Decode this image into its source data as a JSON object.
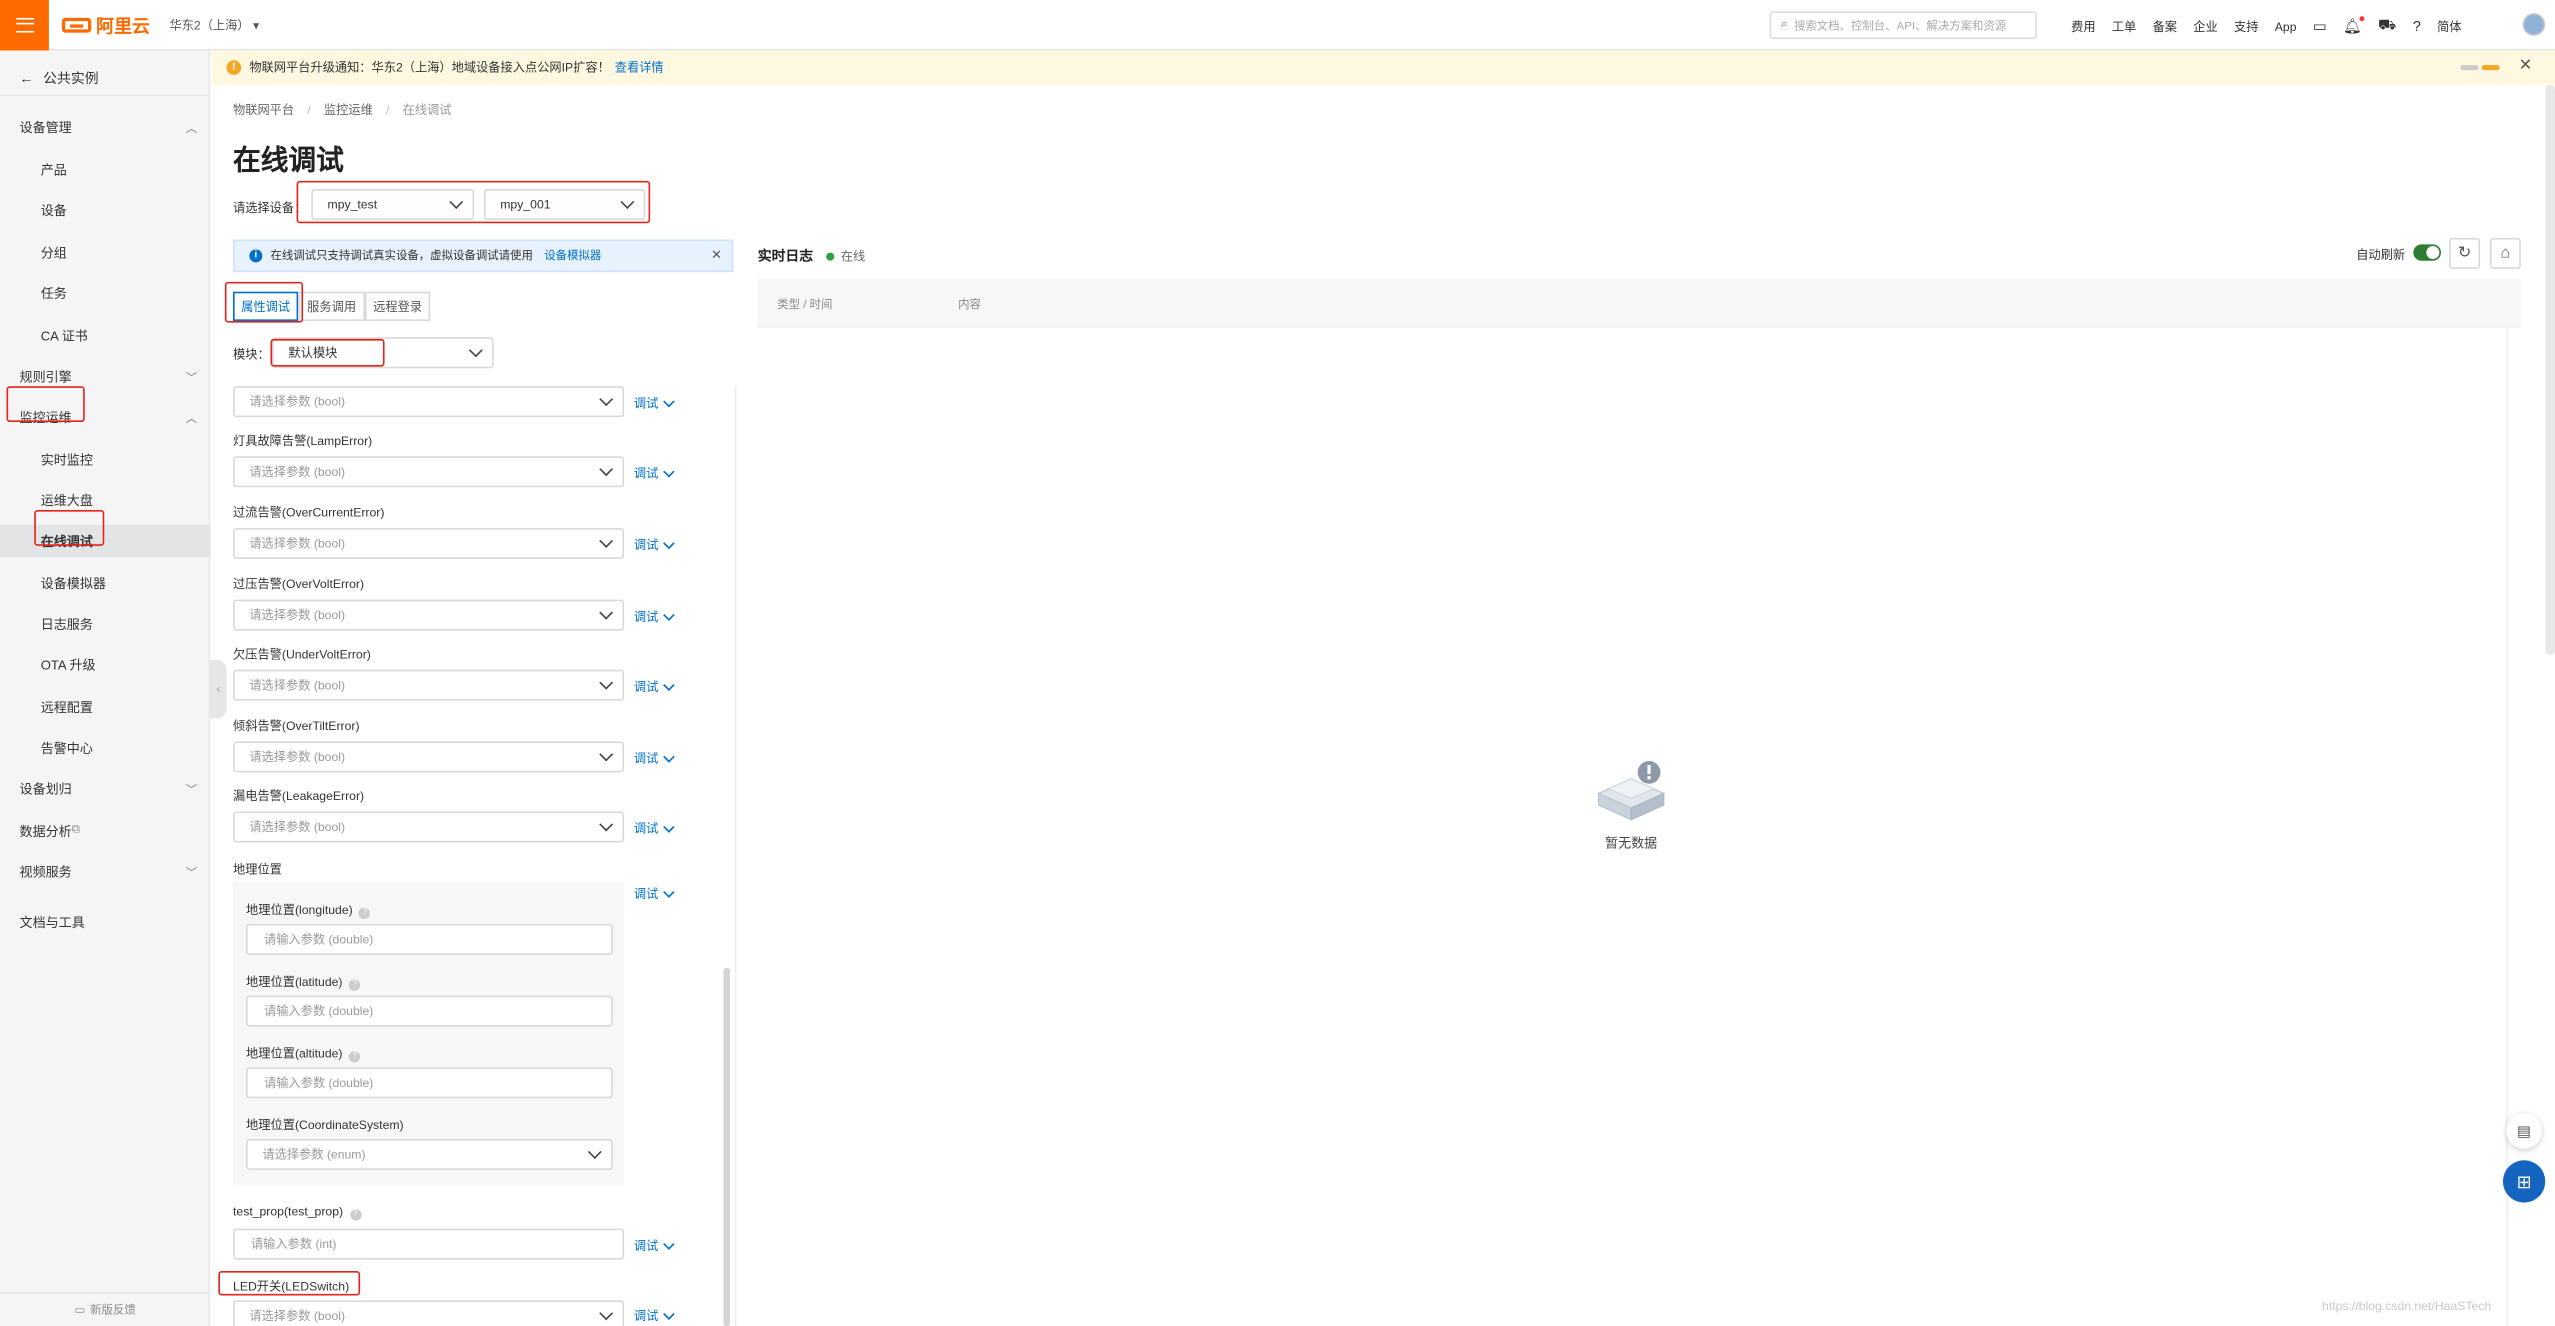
{
  "topbar": {
    "logo_text": "阿里云",
    "region": "华东2（上海）",
    "search_placeholder": "搜索文档、控制台、API、解决方案和资源",
    "links": [
      "费用",
      "工单",
      "备案",
      "企业",
      "支持",
      "App"
    ],
    "lang": "简体"
  },
  "sidebar": {
    "back_label": "公共实例",
    "items": [
      {
        "label": "设备管理",
        "level": 1,
        "chevron": "up"
      },
      {
        "label": "产品",
        "level": 2
      },
      {
        "label": "设备",
        "level": 2
      },
      {
        "label": "分组",
        "level": 2
      },
      {
        "label": "任务",
        "level": 2
      },
      {
        "label": "CA 证书",
        "level": 2
      },
      {
        "label": "规则引擎",
        "level": 1,
        "chevron": "down"
      },
      {
        "label": "监控运维",
        "level": 1,
        "chevron": "up",
        "highlight": true
      },
      {
        "label": "实时监控",
        "level": 2
      },
      {
        "label": "运维大盘",
        "level": 2
      },
      {
        "label": "在线调试",
        "level": 2,
        "active": true,
        "highlight": true
      },
      {
        "label": "设备模拟器",
        "level": 2
      },
      {
        "label": "日志服务",
        "level": 2
      },
      {
        "label": "OTA 升级",
        "level": 2
      },
      {
        "label": "远程配置",
        "level": 2
      },
      {
        "label": "告警中心",
        "level": 2
      },
      {
        "label": "设备划归",
        "level": 1,
        "chevron": "down"
      },
      {
        "label": "数据分析",
        "level": 1,
        "external": true
      },
      {
        "label": "视频服务",
        "level": 1,
        "chevron": "down"
      },
      {
        "label": "文档与工具",
        "level": 1
      }
    ],
    "feedback": "新版反馈"
  },
  "notice": {
    "text": "物联网平台升级通知：华东2（上海）地域设备接入点公网IP扩容！",
    "link": "查看详情"
  },
  "breadcrumb": [
    "物联网平台",
    "/",
    "监控运维",
    "/",
    "在线调试"
  ],
  "page_title": "在线调试",
  "device_select": {
    "label": "请选择设备：",
    "product": "mpy_test",
    "device": "mpy_001"
  },
  "info_bar": {
    "text": "在线调试只支持调试真实设备，虚拟设备调试请使用",
    "link": "设备模拟器"
  },
  "tabs": [
    "属性调试",
    "服务调用",
    "远程登录"
  ],
  "module": {
    "label": "模块：",
    "value": "默认模块"
  },
  "debug_label": "调试",
  "properties": [
    {
      "label": "",
      "placeholder": "请选择参数 (bool)",
      "kind": "select"
    },
    {
      "label": "灯具故障告警(LampError)",
      "placeholder": "请选择参数 (bool)",
      "kind": "select"
    },
    {
      "label": "过流告警(OverCurrentError)",
      "placeholder": "请选择参数 (bool)",
      "kind": "select"
    },
    {
      "label": "过压告警(OverVoltError)",
      "placeholder": "请选择参数 (bool)",
      "kind": "select"
    },
    {
      "label": "欠压告警(UnderVoltError)",
      "placeholder": "请选择参数 (bool)",
      "kind": "select"
    },
    {
      "label": "倾斜告警(OverTiltError)",
      "placeholder": "请选择参数 (bool)",
      "kind": "select"
    },
    {
      "label": "漏电告警(LeakageError)",
      "placeholder": "请选择参数 (bool)",
      "kind": "select"
    }
  ],
  "geo": {
    "label": "地理位置",
    "fields": [
      {
        "label": "地理位置(longitude)",
        "placeholder": "请输入参数 (double)"
      },
      {
        "label": "地理位置(latitude)",
        "placeholder": "请输入参数 (double)"
      },
      {
        "label": "地理位置(altitude)",
        "placeholder": "请输入参数 (double)"
      },
      {
        "label": "地理位置(CoordinateSystem)",
        "placeholder": "请选择参数 (enum)"
      }
    ]
  },
  "test_prop": {
    "label": "test_prop(test_prop)",
    "placeholder": "请输入参数 (int)"
  },
  "led": {
    "label": "LED开关(LEDSwitch)",
    "placeholder": "请选择参数 (bool)"
  },
  "log": {
    "title": "实时日志",
    "status": "在线",
    "auto_refresh": "自动刷新",
    "col_type": "类型 / 时间",
    "col_content": "内容",
    "empty": "暂无数据"
  },
  "watermark": "https://blog.csdn.net/HaaSTech",
  "colors": {
    "brand": "#ff6a00",
    "link": "#0070cc",
    "highlight_box": "#e1251b",
    "online": "#2ea043"
  }
}
